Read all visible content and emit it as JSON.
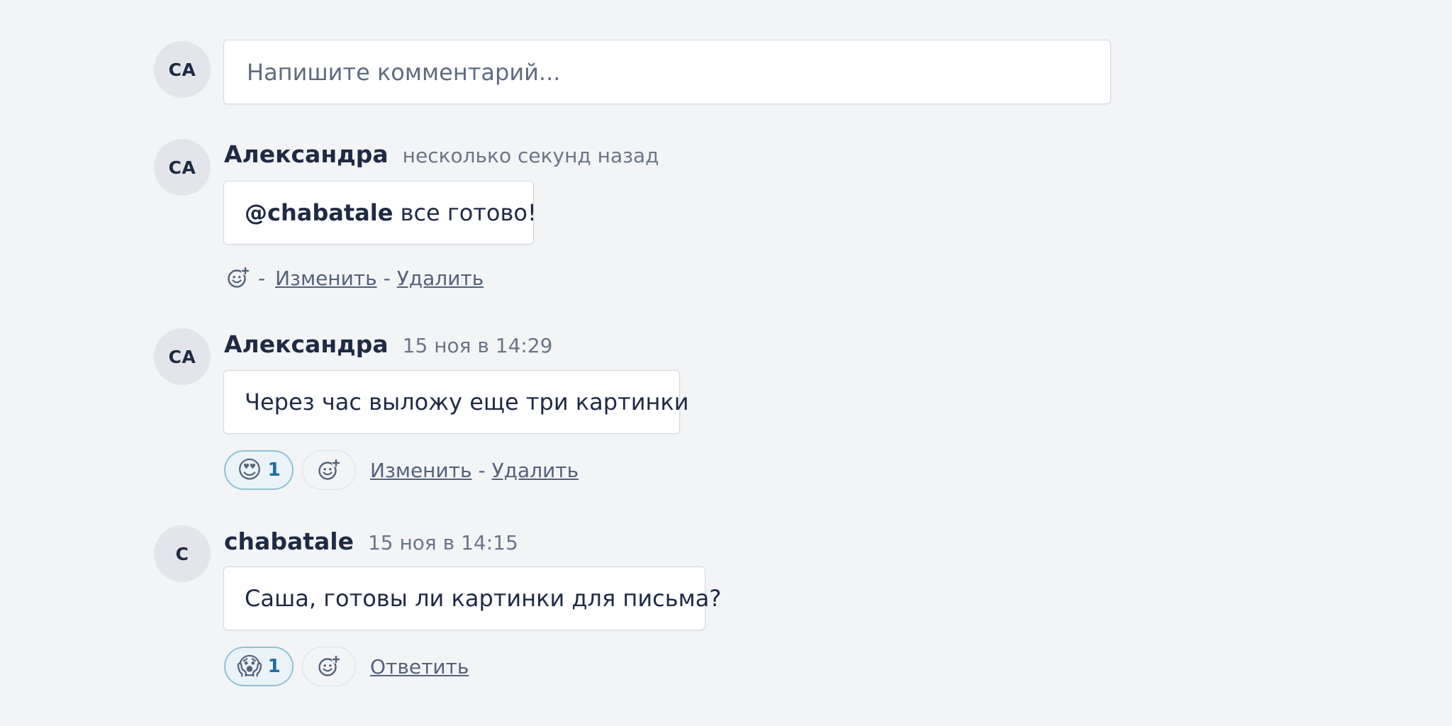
{
  "composer": {
    "avatar": "CA",
    "placeholder": "Напишите комментарий..."
  },
  "comments": [
    {
      "avatar": "CA",
      "author": "Александра",
      "time": "несколько секунд назад",
      "mention": "@chabatale",
      "text": " все готово!",
      "actions": {
        "separator": "-",
        "edit": "Изменить",
        "delete": "Удалить"
      }
    },
    {
      "avatar": "CA",
      "author": "Александра",
      "time": "15 ноя в 14:29",
      "text": "Через час выложу еще три картинки",
      "reaction": {
        "emoji": "😍",
        "icon": "heart-eyes-emoji",
        "count": "1"
      },
      "actions": {
        "edit": "Изменить",
        "separator": "-",
        "delete": "Удалить"
      }
    },
    {
      "avatar": "C",
      "author": "chabatale",
      "time": "15 ноя в 14:15",
      "text": "Саша, готовы ли картинки для письма?",
      "reaction": {
        "emoji": "😱",
        "icon": "screaming-emoji",
        "count": "1"
      },
      "actions": {
        "reply": "Ответить"
      }
    }
  ],
  "colors": {
    "background": "#f3f4f6",
    "text": "#1f2a44",
    "muted": "#6b7588",
    "reaction_border": "#8ec3d6",
    "reaction_count": "#1c6fa3"
  }
}
